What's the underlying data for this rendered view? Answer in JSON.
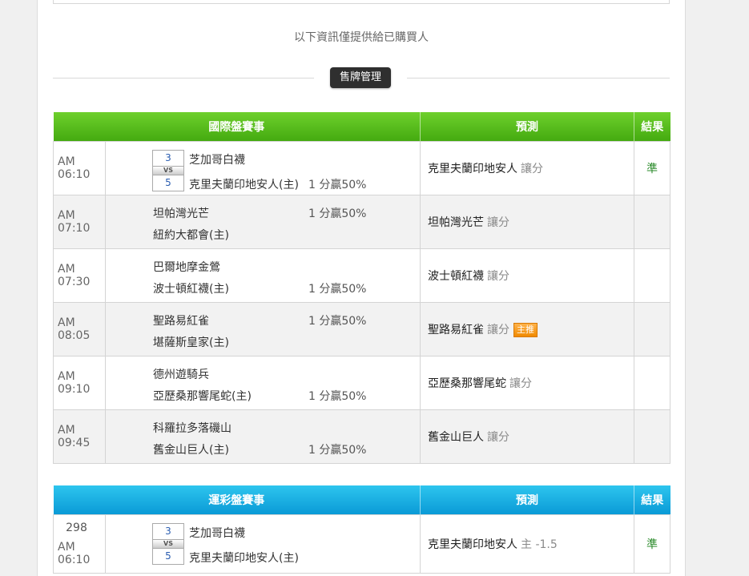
{
  "notice": "以下資訊僅提供給已購買人",
  "sell_button": "售牌管理",
  "table1": {
    "headers": {
      "game": "國際盤賽事",
      "prediction": "預測",
      "result": "結果"
    },
    "rows": [
      {
        "time": "AM 06:10",
        "away": "芝加哥白襪",
        "home": "克里夫蘭印地安人(主)",
        "score_away": "3",
        "vs": "VS",
        "score_home": "5",
        "odds": "1 分贏50%",
        "pick": "克里夫蘭印地安人",
        "sub": "讓分",
        "result": "準"
      },
      {
        "time": "AM 07:10",
        "away": "坦帕灣光芒",
        "home": "紐約大都會(主)",
        "odds": "1 分贏50%",
        "pick": "坦帕灣光芒",
        "sub": "讓分"
      },
      {
        "time": "AM 07:30",
        "away": "巴爾地摩金鶯",
        "home": "波士頓紅襪(主)",
        "odds": "1 分贏50%",
        "pick": "波士頓紅襪",
        "sub": "讓分"
      },
      {
        "time": "AM 08:05",
        "away": "聖路易紅雀",
        "home": "堪薩斯皇家(主)",
        "odds": "1 分贏50%",
        "pick": "聖路易紅雀",
        "sub": "讓分",
        "badge": "主推"
      },
      {
        "time": "AM 09:10",
        "away": "德州遊騎兵",
        "home": "亞歷桑那響尾蛇(主)",
        "odds": "1 分贏50%",
        "pick": "亞歷桑那響尾蛇",
        "sub": "讓分"
      },
      {
        "time": "AM 09:45",
        "away": "科羅拉多落磯山",
        "home": "舊金山巨人(主)",
        "odds": "1 分贏50%",
        "pick": "舊金山巨人",
        "sub": "讓分"
      }
    ]
  },
  "table2": {
    "headers": {
      "game": "運彩盤賽事",
      "prediction": "預測",
      "result": "結果"
    },
    "rows": [
      {
        "num": "298",
        "time": "AM 06:10",
        "away": "芝加哥白襪",
        "home": "克里夫蘭印地安人(主)",
        "score_away": "3",
        "vs": "VS",
        "score_home": "5",
        "pick": "克里夫蘭印地安人",
        "sub": "主 -1.5",
        "result": "準"
      }
    ]
  }
}
